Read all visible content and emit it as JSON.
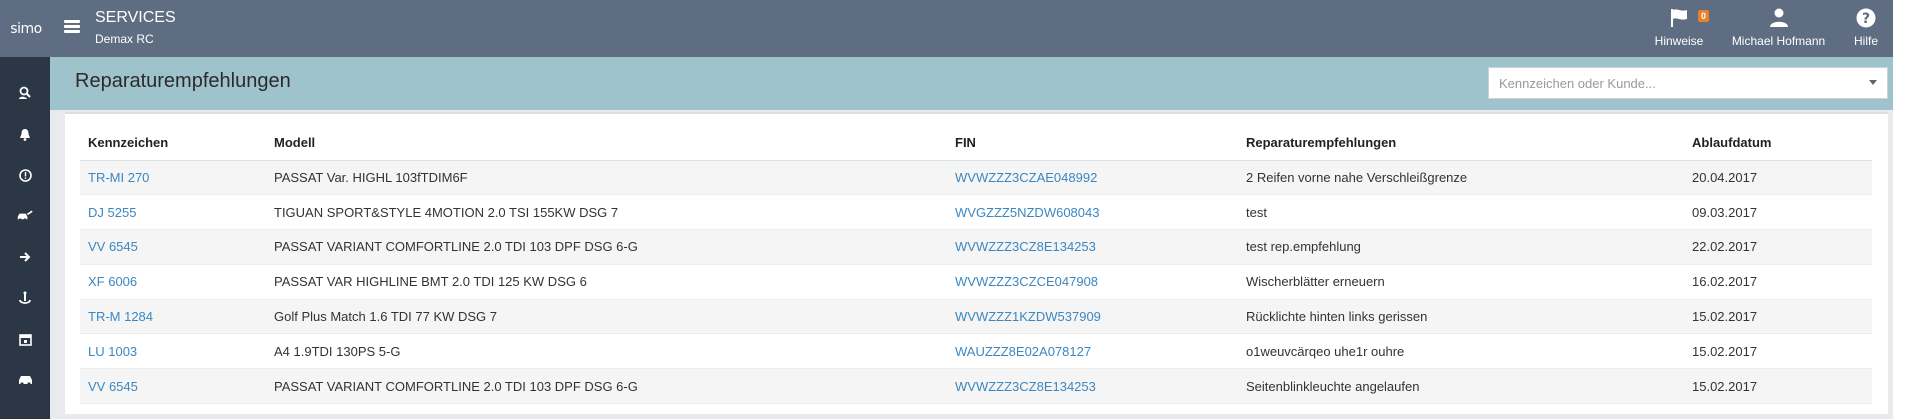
{
  "header": {
    "logo_text": "simo",
    "app_title": "SERVICES",
    "app_subtitle": "Demax RC",
    "hinweise_label": "Hinweise",
    "hinweise_count": "0",
    "user_name": "Michael Hofmann",
    "help_label": "Hilfe",
    "icons": {
      "menu": "hamburger-icon",
      "hinweise": "flag-icon",
      "user": "user-icon",
      "help": "help-icon"
    }
  },
  "sidebar": {
    "items": [
      {
        "icon": "search-person-icon"
      },
      {
        "icon": "bell-icon"
      },
      {
        "icon": "alert-circle-icon"
      },
      {
        "icon": "car-repair-icon"
      },
      {
        "icon": "arrow-right-icon"
      },
      {
        "icon": "anchor-icon"
      },
      {
        "icon": "calendar-icon"
      },
      {
        "icon": "car-icon"
      }
    ]
  },
  "page": {
    "title": "Reparaturempfehlungen",
    "search_placeholder": "Kennzeichen oder Kunde..."
  },
  "table": {
    "columns": [
      "Kennzeichen",
      "Modell",
      "FIN",
      "Reparaturempfehlungen",
      "Ablaufdatum"
    ],
    "rows": [
      {
        "kennzeichen": "TR-MI 270",
        "modell": "PASSAT Var. HIGHL 103fTDIM6F",
        "fin": "WVWZZZ3CZAE048992",
        "empfehlung": "2 Reifen vorne nahe Verschleißgrenze",
        "datum": "20.04.2017"
      },
      {
        "kennzeichen": "DJ 5255",
        "modell": "TIGUAN SPORT&STYLE 4MOTION 2.0 TSI 155KW DSG 7",
        "fin": "WVGZZZ5NZDW608043",
        "empfehlung": "test",
        "datum": "09.03.2017"
      },
      {
        "kennzeichen": "VV 6545",
        "modell": "PASSAT VARIANT COMFORTLINE 2.0 TDI 103 DPF DSG 6-G",
        "fin": "WVWZZZ3CZ8E134253",
        "empfehlung": "test rep.empfehlung",
        "datum": "22.02.2017"
      },
      {
        "kennzeichen": "XF 6006",
        "modell": "PASSAT VAR HIGHLINE BMT 2.0 TDI 125 KW DSG 6",
        "fin": "WVWZZZ3CZCE047908",
        "empfehlung": "Wischerblätter erneuern",
        "datum": "16.02.2017"
      },
      {
        "kennzeichen": "TR-M 1284",
        "modell": "Golf Plus Match 1.6 TDI 77 KW DSG 7",
        "fin": "WVWZZZ1KZDW537909",
        "empfehlung": "Rücklichte hinten links gerissen",
        "datum": "15.02.2017"
      },
      {
        "kennzeichen": "LU 1003",
        "modell": "A4 1.9TDI 130PS 5-G",
        "fin": "WAUZZZ8E02A078127",
        "empfehlung": "o1weuvcärqeo uhe1r ouhre",
        "datum": "15.02.2017"
      },
      {
        "kennzeichen": "VV 6545",
        "modell": "PASSAT VARIANT COMFORTLINE 2.0 TDI 103 DPF DSG 6-G",
        "fin": "WVWZZZ3CZ8E134253",
        "empfehlung": "Seitenblinkleuchte angelaufen",
        "datum": "15.02.2017"
      }
    ]
  },
  "colors": {
    "topbar": "#5e6d82",
    "sidebar": "#2c3745",
    "page_header": "#9fc3cc",
    "link": "#3c87c0",
    "badge": "#e8822a"
  }
}
